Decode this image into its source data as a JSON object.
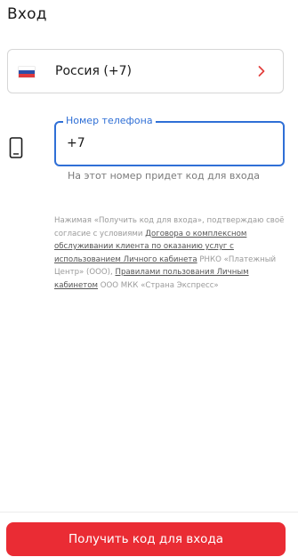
{
  "header": {
    "title": "Вход"
  },
  "country": {
    "label": "Россия (+7)",
    "flag_colors": [
      "#ffffff",
      "#2b4ea8",
      "#e03a3e"
    ],
    "icon": "chevron-right-icon",
    "chevron_color": "#e2403e"
  },
  "phone": {
    "icon": "smartphone-icon",
    "field_label": "Номер телефона",
    "value": "+7",
    "hint": "На этот номер придет код для входа",
    "accent_color": "#2f6fd6"
  },
  "consent": {
    "part1": "Нажимая «Получить код для входа», подтверждаю своё согласие с условиями ",
    "link1": "Договора о комплексном обслуживании клиента по оказанию услуг с использованием Личного кабинета",
    "part2": " РНКО «Платежный Центр» (ООО), ",
    "link2": "Правилами пользования Личным кабинетом",
    "part3": " ООО МКК «Страна Экспресс»"
  },
  "action": {
    "submit_label": "Получить код для входа",
    "color": "#ea2c34"
  }
}
